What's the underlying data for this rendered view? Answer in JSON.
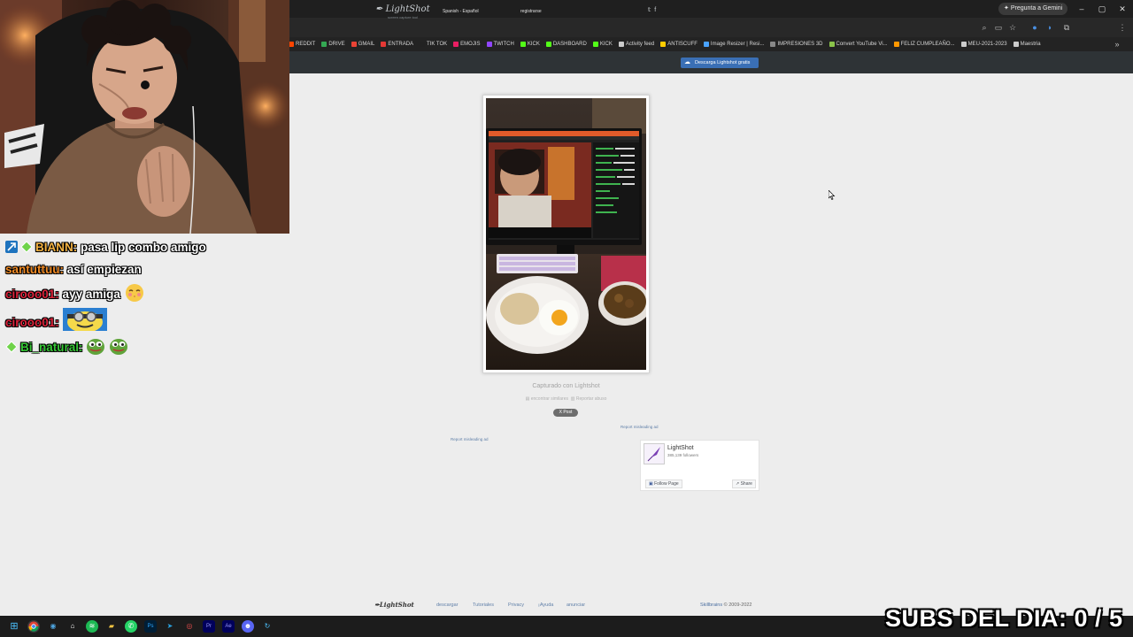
{
  "browser": {
    "gemini_label": "Pregunta a Gemini",
    "window_controls": [
      "–",
      "▢",
      "✕"
    ],
    "bookmarks": [
      {
        "label": "REDDIT",
        "color": "#ff4500"
      },
      {
        "label": "DRIVE",
        "color": "#34a853"
      },
      {
        "label": "GMAIL",
        "color": "#ea4335"
      },
      {
        "label": "ENTRADA",
        "color": "#e53935"
      },
      {
        "label": "TIK TOK",
        "color": "#222222"
      },
      {
        "label": "EMOJIS",
        "color": "#e91e63"
      },
      {
        "label": "TWITCH",
        "color": "#9146ff"
      },
      {
        "label": "KICK",
        "color": "#53fc18"
      },
      {
        "label": "DASHBOARD",
        "color": "#53fc18"
      },
      {
        "label": "KICK",
        "color": "#53fc18"
      },
      {
        "label": "Activity feed",
        "color": "#cccccc"
      },
      {
        "label": "ANTISCUFF",
        "color": "#ffcc00"
      },
      {
        "label": "Image Resizer | Resi...",
        "color": "#4aa3ff"
      },
      {
        "label": "IMPRESIONES 3D",
        "color": "#888888"
      },
      {
        "label": "Convert YouTube Vi...",
        "color": "#8bc34a"
      },
      {
        "label": "FELIZ CUMPLEAÑO...",
        "color": "#ff9800"
      },
      {
        "label": "MEU-2021-2023",
        "color": "#cccccc"
      },
      {
        "label": "Maestria",
        "color": "#cccccc"
      }
    ]
  },
  "lightshot": {
    "logo": "LightShot",
    "tagline": "screen capture tool",
    "language": "Spanish - Español",
    "register": "registrarse",
    "download_button": "Descarga Lightshot gratis",
    "captured_text": "Capturado con Lightshot",
    "find_similar": "encontrar similares",
    "report_abuse": "Reportar abuso",
    "x_post": "X Post",
    "report_ad_right": "Report misleading ad",
    "report_ad_left": "Report misleading ad",
    "fb_widget": {
      "name": "LightShot",
      "followers": "385,139 followers",
      "follow": "Follow Page",
      "share": "Share"
    },
    "footer": {
      "logo": "LightShot",
      "links": [
        "descargar",
        "Tutoriales",
        "Privacy",
        "¡Ayuda",
        "anunciar"
      ],
      "brand": "Skillbrains",
      "copyright": "© 2009-2022"
    }
  },
  "stream": {
    "chat": [
      {
        "user": "BIANN",
        "message": "pasa lip combo amigo",
        "user_color": "#f5b342"
      },
      {
        "user": "santuttuu",
        "message": "así empiezan",
        "user_color": "#f08a24"
      },
      {
        "user": "cirooo01",
        "message": "ayy amiga",
        "user_color": "#e0243c"
      },
      {
        "user": "cirooo01",
        "message": "",
        "user_color": "#e0243c"
      },
      {
        "user": "Bi_natural",
        "message": "",
        "user_color": "#37c837"
      }
    ],
    "subs_counter": "SUBS DEL DIA: 0 / 5"
  }
}
